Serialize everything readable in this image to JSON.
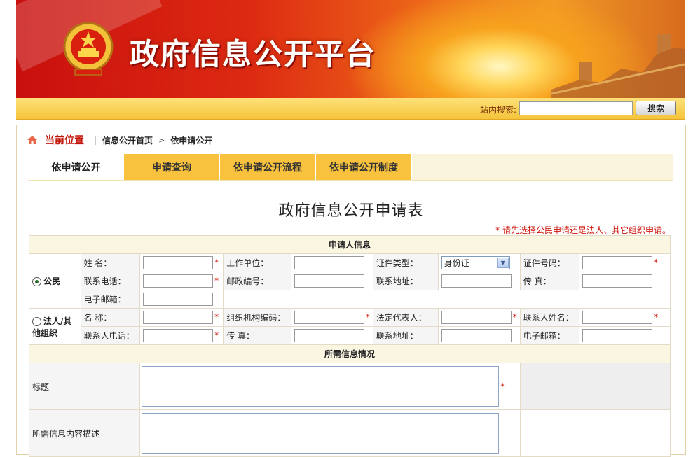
{
  "header": {
    "title": "政府信息公开平台"
  },
  "search": {
    "label": "站内搜索:",
    "button_label": "搜索",
    "value": ""
  },
  "breadcrumb": {
    "current_label": "当前位置",
    "sep": "|",
    "home_link": "信息公开首页",
    "arrow": ">",
    "page": "依申请公开"
  },
  "tabs": [
    "依申请公开",
    "申请查询",
    "依申请公开流程",
    "依申请公开制度"
  ],
  "form": {
    "title": "政府信息公开申请表",
    "note": "* 请先选择公民申请还是法人、其它组织申请。",
    "applicant_section": "申请人信息",
    "citizen_label": "公民",
    "org_label_1": "法人/其",
    "org_label_2": "他组织",
    "citizen": {
      "name": "姓 名：",
      "work_unit": "工作单位：",
      "id_type": "证件类型：",
      "id_type_value": "身份证",
      "id_number": "证件号码：",
      "phone": "联系电话：",
      "postcode": "邮政编号：",
      "address": "联系地址：",
      "fax": "传 真：",
      "email": "电子邮箱："
    },
    "org": {
      "name": "名 称：",
      "org_code": "组织机构编码：",
      "legal_rep": "法定代表人：",
      "contact_name": "联系人姓名：",
      "contact_phone": "联系人电话：",
      "fax": "传 真：",
      "address": "联系地址：",
      "email": "电子邮箱："
    },
    "info_section": "所需信息情况",
    "title_label": "标题",
    "desc_label": "所需信息内容描述",
    "req": "*"
  }
}
